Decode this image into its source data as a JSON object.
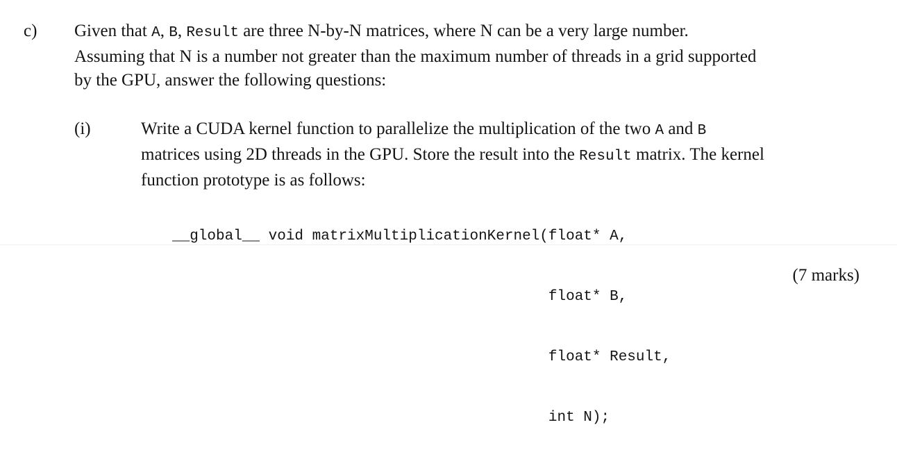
{
  "question_c": {
    "label": "c)",
    "line1": {
      "t1": "Given that ",
      "m1": "A",
      "t2": ", ",
      "m2": "B",
      "t3": ", ",
      "m3": "Result",
      "t4": " are three N-by-N matrices, where N can be a very large number."
    },
    "line2": "Assuming that N is a number not greater than the maximum number of threads in a grid supported",
    "line3": "by the GPU, answer the following questions:"
  },
  "question_i": {
    "label": "(i)",
    "line1": {
      "t1": "Write a CUDA kernel function to parallelize the multiplication of the two ",
      "m1": "A",
      "t2": " and ",
      "m2": "B"
    },
    "line2": {
      "t1": "matrices using 2D threads in the GPU. Store the result into the ",
      "m1": "Result",
      "t2": " matrix. The kernel"
    },
    "line3": "function prototype is as follows:",
    "code": [
      "__global__ void matrixMultiplicationKernel(float* A,",
      "                                           float* B,",
      "                                           float* Result,",
      "                                           int N);"
    ],
    "marks": "(7 marks)"
  }
}
